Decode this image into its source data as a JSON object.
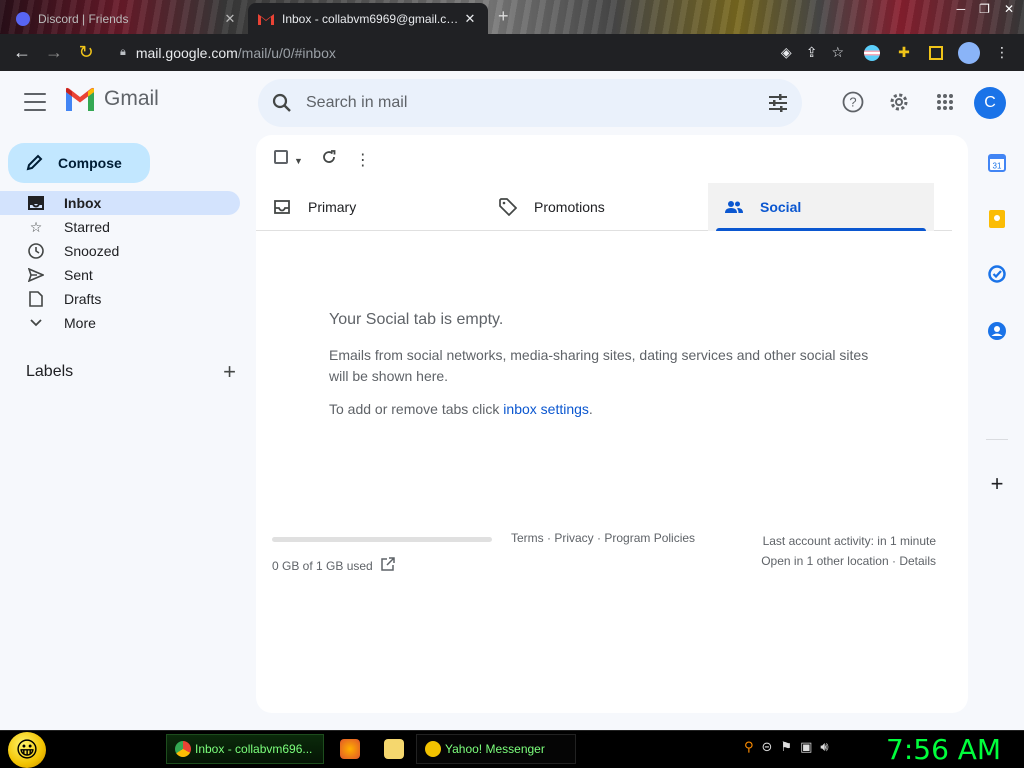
{
  "browser": {
    "tabs": [
      {
        "title": "Discord | Friends",
        "active": false
      },
      {
        "title": "Inbox - collabvm6969@gmail.com",
        "active": true
      }
    ],
    "url_host": "mail.google.com",
    "url_path": "/mail/u/0/#inbox"
  },
  "gmail": {
    "logo_text": "Gmail",
    "search_placeholder": "Search in mail",
    "avatar_letter": "C",
    "compose_label": "Compose",
    "nav": [
      {
        "label": "Inbox",
        "icon": "inbox-icon",
        "active": true
      },
      {
        "label": "Starred",
        "icon": "star-icon"
      },
      {
        "label": "Snoozed",
        "icon": "clock-icon"
      },
      {
        "label": "Sent",
        "icon": "send-icon"
      },
      {
        "label": "Drafts",
        "icon": "draft-icon"
      },
      {
        "label": "More",
        "icon": "chevron-down-icon"
      }
    ],
    "labels_title": "Labels",
    "tabs": [
      {
        "label": "Primary",
        "icon": "inbox-icon"
      },
      {
        "label": "Promotions",
        "icon": "tag-icon"
      },
      {
        "label": "Social",
        "icon": "people-icon",
        "selected": true
      }
    ],
    "empty": {
      "title": "Your Social tab is empty.",
      "description": "Emails from social networks, media-sharing sites, dating services and other social sites will be shown here.",
      "settings_prefix": "To add or remove tabs click ",
      "settings_link": "inbox settings",
      "settings_suffix": "."
    },
    "footer": {
      "storage": "0 GB of 1 GB used",
      "storage_fraction": 0,
      "terms": "Terms",
      "privacy": "Privacy",
      "program_policies": "Program Policies",
      "activity_line1": "Last account activity: in 1 minute",
      "activity_line2_prefix": "Open in 1 other location · ",
      "activity_details": "Details"
    },
    "colors": {
      "accent": "#0b57d0",
      "compose_bg": "#c2e7ff",
      "active_nav": "#d3e3fd",
      "avatar": "#1a73e8"
    }
  },
  "taskbar": {
    "buttons": [
      {
        "label": "Inbox - collabvm696..."
      },
      {
        "label": "Yahoo! Messenger"
      }
    ],
    "clock": "7:56 AM"
  }
}
